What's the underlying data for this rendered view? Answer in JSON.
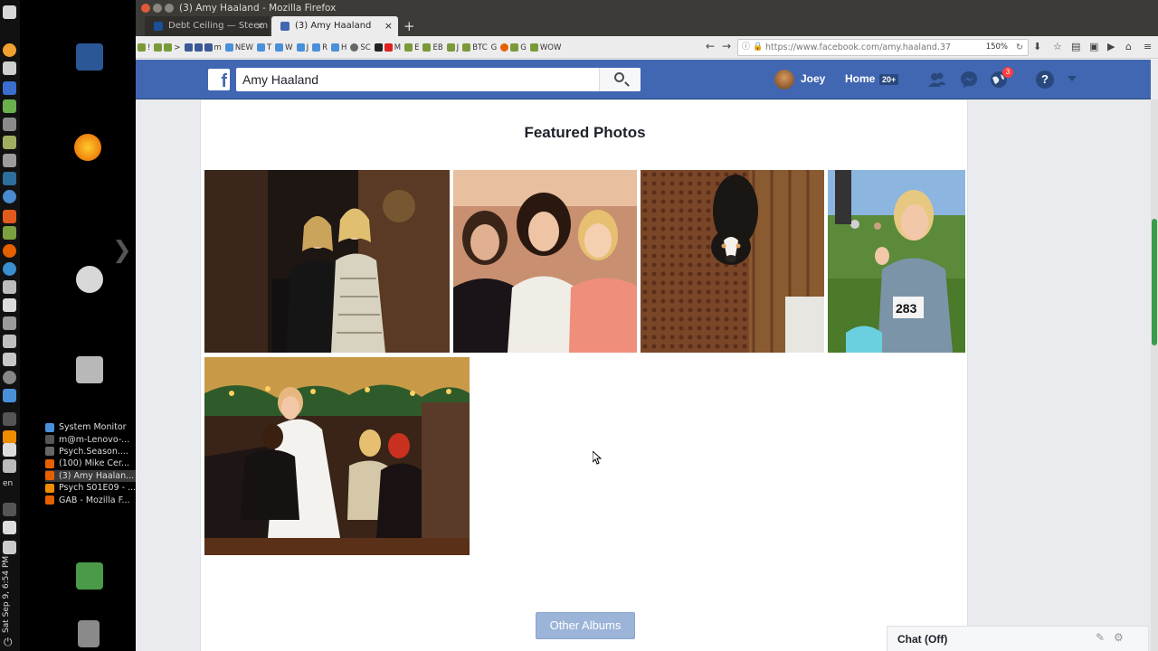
{
  "os": {
    "clock": "Sat Sep 9, 6:54 PM",
    "lang": "en",
    "power_symbol": "⏻"
  },
  "desktop": {
    "arrow_symbol": "❯",
    "tasks": [
      {
        "label": "System Monitor",
        "color": "#4a90d9"
      },
      {
        "label": "m@m-Lenovo-...",
        "color": "#555555"
      },
      {
        "label": "Psych.Season....",
        "color": "#666666"
      },
      {
        "label": "(100) Mike Cer...",
        "color": "#e66000"
      },
      {
        "label": "(3) Amy Haalan...",
        "color": "#e66000"
      },
      {
        "label": "Psych S01E09 - ...",
        "color": "#f08c00"
      },
      {
        "label": "GAB - Mozilla F...",
        "color": "#e66000"
      }
    ]
  },
  "browser": {
    "window_title": "(3) Amy Haaland - Mozilla Firefox",
    "tabs": [
      {
        "label": "Debt Ceiling — Steem"
      },
      {
        "label": "(3) Amy Haaland"
      }
    ],
    "close_symbol": "×",
    "new_tab_symbol": "+",
    "back_symbol": "←",
    "forward_symbol": "→",
    "url": "https://www.facebook.com/amy.haaland.37",
    "zoom": "150%",
    "reload_symbol": "↻",
    "secure_symbol": "🔒",
    "info_symbol": "ⓘ",
    "bookmarks": [
      "!",
      ">",
      "m",
      "NEW",
      "T",
      "W",
      "J",
      "R",
      "H",
      "SC",
      "M",
      "E",
      "EB",
      "J",
      "BTC",
      "G",
      "G",
      "WOW"
    ]
  },
  "facebook": {
    "logo": "f",
    "search_value": "Amy Haaland",
    "user_name": "Joey",
    "home_label": "Home",
    "home_badge": "20+",
    "notif_badge": "3",
    "help_symbol": "?",
    "section_title": "Featured Photos",
    "other_albums_label": "Other Albums",
    "chat_label": "Chat (Off)",
    "compose_symbol": "✎",
    "gear_symbol": "⚙"
  },
  "colors": {
    "fb_blue": "#4267b2",
    "fb_dark_blue": "#29487d",
    "badge_red": "#fa3e3e"
  }
}
